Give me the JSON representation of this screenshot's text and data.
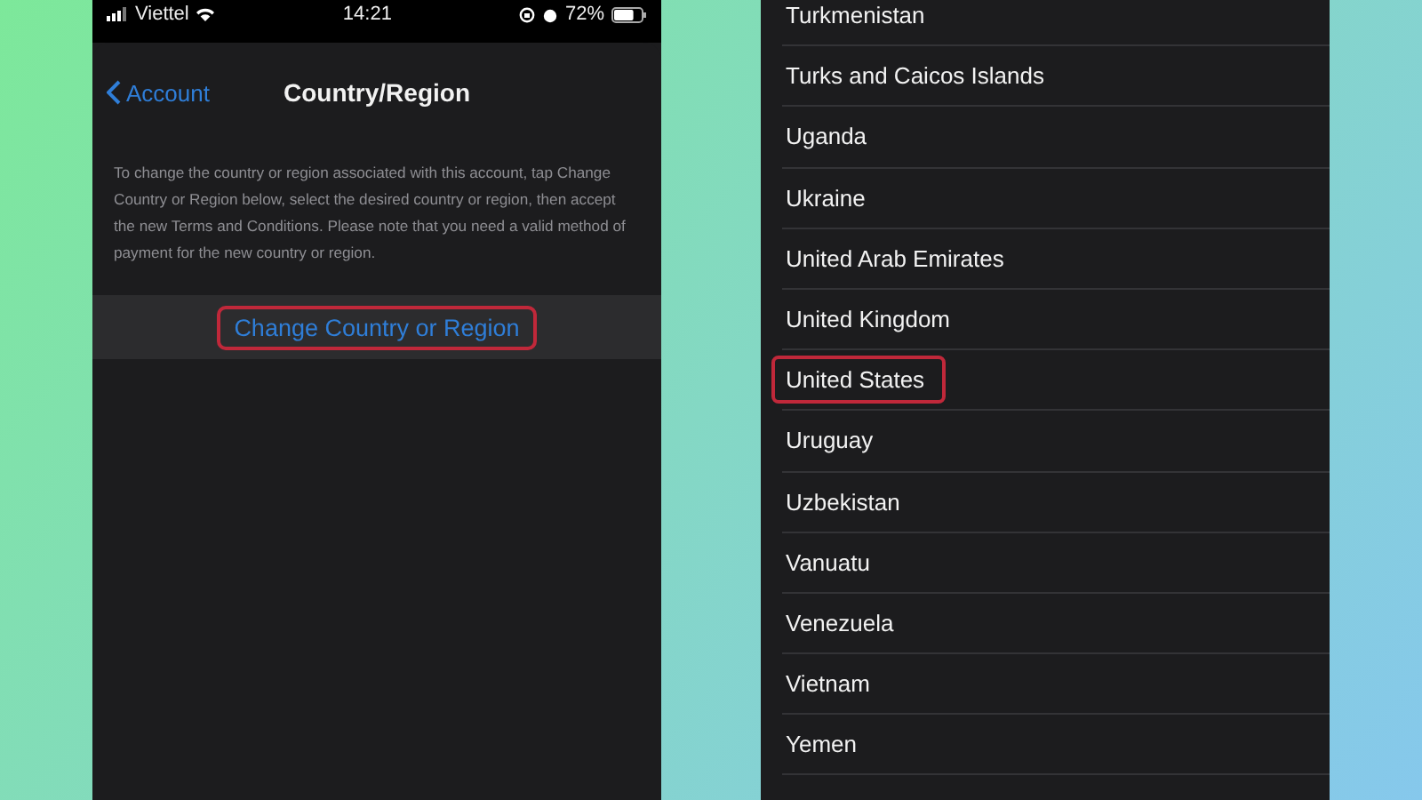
{
  "left_phone": {
    "status_bar": {
      "carrier": "Viettel",
      "time": "14:21",
      "battery": "72%"
    },
    "nav": {
      "back": "Account",
      "title": "Country/Region"
    },
    "description": "To change the country or region associated with this account, tap Change Country or Region below, select the desired country or region, then accept the new Terms and Conditions. Please note that you need a valid method of payment for the new country or region.",
    "action": {
      "label": "Change Country or Region",
      "highlighted": true
    }
  },
  "right_phone": {
    "countries": [
      {
        "name": "Turkmenistan",
        "highlighted": false
      },
      {
        "name": "Turks and Caicos Islands",
        "highlighted": false
      },
      {
        "name": "Uganda",
        "highlighted": false
      },
      {
        "name": "Ukraine",
        "highlighted": false
      },
      {
        "name": "United Arab Emirates",
        "highlighted": false
      },
      {
        "name": "United Kingdom",
        "highlighted": false
      },
      {
        "name": "United States",
        "highlighted": true
      },
      {
        "name": "Uruguay",
        "highlighted": false
      },
      {
        "name": "Uzbekistan",
        "highlighted": false
      },
      {
        "name": "Vanuatu",
        "highlighted": false
      },
      {
        "name": "Venezuela",
        "highlighted": false
      },
      {
        "name": "Vietnam",
        "highlighted": false
      },
      {
        "name": "Yemen",
        "highlighted": false
      }
    ]
  }
}
